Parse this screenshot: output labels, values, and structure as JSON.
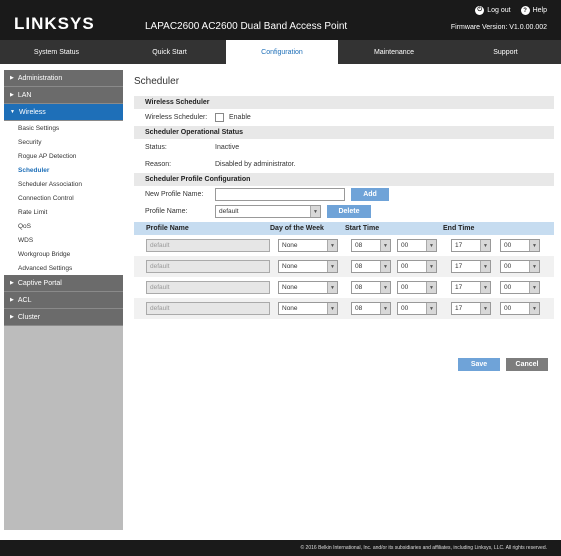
{
  "header": {
    "logo": "LINKSYS",
    "product": "LAPAC2600 AC2600 Dual Band Access Point",
    "logout": "Log out",
    "help": "Help",
    "firmware": "Firmware Version: V1.0.00.002"
  },
  "nav": {
    "tabs": [
      {
        "label": "System Status"
      },
      {
        "label": "Quick Start"
      },
      {
        "label": "Configuration"
      },
      {
        "label": "Maintenance"
      },
      {
        "label": "Support"
      }
    ],
    "active": "Configuration"
  },
  "sidebar": {
    "sections": [
      {
        "label": "Administration"
      },
      {
        "label": "LAN"
      },
      {
        "label": "Wireless"
      },
      {
        "label": "Captive Portal"
      },
      {
        "label": "ACL"
      },
      {
        "label": "Cluster"
      }
    ],
    "wireless_items": [
      {
        "label": "Basic Settings"
      },
      {
        "label": "Security"
      },
      {
        "label": "Rogue AP Detection"
      },
      {
        "label": "Scheduler"
      },
      {
        "label": "Scheduler Association"
      },
      {
        "label": "Connection Control"
      },
      {
        "label": "Rate Limit"
      },
      {
        "label": "QoS"
      },
      {
        "label": "WDS"
      },
      {
        "label": "Workgroup Bridge"
      },
      {
        "label": "Advanced Settings"
      }
    ],
    "active_item": "Scheduler"
  },
  "main": {
    "title": "Scheduler",
    "wireless_scheduler": {
      "section": "Wireless Scheduler",
      "label": "Wireless Scheduler:",
      "checkbox_label": "Enable"
    },
    "operational_status": {
      "section": "Scheduler Operational Status",
      "status_label": "Status:",
      "status_value": "Inactive",
      "reason_label": "Reason:",
      "reason_value": "Disabled by administrator."
    },
    "profile_config": {
      "section": "Scheduler Profile Configuration",
      "new_profile_label": "New Profile Name:",
      "new_profile_value": "",
      "add_label": "Add",
      "profile_name_label": "Profile Name:",
      "profile_name_value": "default",
      "delete_label": "Delete"
    },
    "table": {
      "headers": {
        "profile_name": "Profile Name",
        "day_of_week": "Day of the Week",
        "start_time": "Start Time",
        "end_time": "End Time"
      },
      "rows": [
        {
          "profile": "default",
          "day": "None",
          "start_h": "08",
          "start_m": "00",
          "end_h": "17",
          "end_m": "00"
        },
        {
          "profile": "default",
          "day": "None",
          "start_h": "08",
          "start_m": "00",
          "end_h": "17",
          "end_m": "00"
        },
        {
          "profile": "default",
          "day": "None",
          "start_h": "08",
          "start_m": "00",
          "end_h": "17",
          "end_m": "00"
        },
        {
          "profile": "default",
          "day": "None",
          "start_h": "08",
          "start_m": "00",
          "end_h": "17",
          "end_m": "00"
        }
      ]
    },
    "save_label": "Save",
    "cancel_label": "Cancel"
  },
  "footer": {
    "text": "© 2016 Belkin International, Inc. and/or its subsidiaries and affiliates, including Linksys, LLC. All rights reserved."
  },
  "colors": {
    "header_bg": "#1a1a1a",
    "nav_bg": "#333333",
    "accent": "#1e6fb8",
    "button": "#6fa3d8",
    "table_header": "#c6dcf0"
  }
}
